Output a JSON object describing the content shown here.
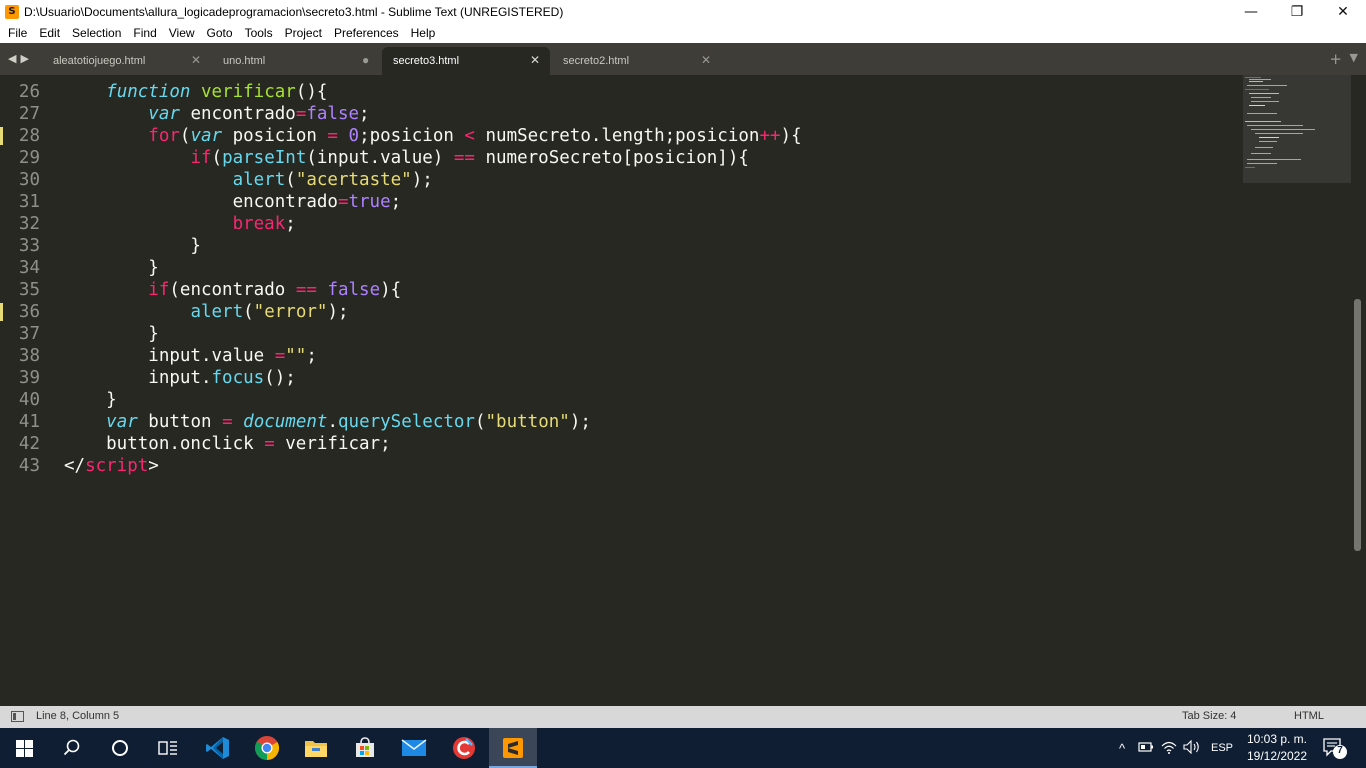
{
  "window": {
    "title": "D:\\Usuario\\Documents\\allura_logicadeprogramacion\\secreto3.html - Sublime Text (UNREGISTERED)",
    "app_icon_letter": "S",
    "minimize": "—",
    "maximize": "❐",
    "close": "✕"
  },
  "menu": [
    "File",
    "Edit",
    "Selection",
    "Find",
    "View",
    "Goto",
    "Tools",
    "Project",
    "Preferences",
    "Help"
  ],
  "tabs": [
    {
      "label": "aleatotiojuego.html",
      "state": "close"
    },
    {
      "label": "uno.html",
      "state": "modified"
    },
    {
      "label": "secreto3.html",
      "state": "active"
    },
    {
      "label": "secreto2.html",
      "state": "close"
    }
  ],
  "tab_controls": {
    "prev": "◀",
    "next": "▶",
    "new": "+",
    "more": "▼"
  },
  "code_lines": [
    {
      "n": "26",
      "mark": false
    },
    {
      "n": "27",
      "mark": false
    },
    {
      "n": "28",
      "mark": true
    },
    {
      "n": "29",
      "mark": false
    },
    {
      "n": "30",
      "mark": false
    },
    {
      "n": "31",
      "mark": false
    },
    {
      "n": "32",
      "mark": false
    },
    {
      "n": "33",
      "mark": false
    },
    {
      "n": "34",
      "mark": false
    },
    {
      "n": "35",
      "mark": false
    },
    {
      "n": "36",
      "mark": true
    },
    {
      "n": "37",
      "mark": false
    },
    {
      "n": "38",
      "mark": false
    },
    {
      "n": "39",
      "mark": false
    },
    {
      "n": "40",
      "mark": false
    },
    {
      "n": "41",
      "mark": false
    },
    {
      "n": "42",
      "mark": false
    },
    {
      "n": "43",
      "mark": false
    }
  ],
  "code": [
    [
      [
        "    ",
        "pl"
      ],
      [
        "function",
        "sk"
      ],
      [
        " ",
        "pl"
      ],
      [
        "verificar",
        "fn"
      ],
      [
        "(){",
        "pl"
      ]
    ],
    [
      [
        "        ",
        "pl"
      ],
      [
        "var",
        "sk"
      ],
      [
        " encontrado",
        "pl"
      ],
      [
        "=",
        "op"
      ],
      [
        "false",
        "cn"
      ],
      [
        ";",
        "pl"
      ]
    ],
    [
      [
        "        ",
        "pl"
      ],
      [
        "for",
        "kw"
      ],
      [
        "(",
        "pl"
      ],
      [
        "var",
        "sk"
      ],
      [
        " posicion ",
        "pl"
      ],
      [
        "=",
        "op"
      ],
      [
        " ",
        "pl"
      ],
      [
        "0",
        "cn"
      ],
      [
        ";posicion ",
        "pl"
      ],
      [
        "<",
        "op"
      ],
      [
        " numSecreto.length;posicion",
        "pl"
      ],
      [
        "++",
        "op"
      ],
      [
        "){",
        "pl"
      ]
    ],
    [
      [
        "            ",
        "pl"
      ],
      [
        "if",
        "kw"
      ],
      [
        "(",
        "pl"
      ],
      [
        "parseInt",
        "bi"
      ],
      [
        "(input.value) ",
        "pl"
      ],
      [
        "==",
        "op"
      ],
      [
        " numeroSecreto[posicion]){",
        "pl"
      ]
    ],
    [
      [
        "                ",
        "pl"
      ],
      [
        "alert",
        "bi"
      ],
      [
        "(",
        "pl"
      ],
      [
        "\"acertaste\"",
        "str"
      ],
      [
        ");",
        "pl"
      ]
    ],
    [
      [
        "                encontrado",
        "pl"
      ],
      [
        "=",
        "op"
      ],
      [
        "true",
        "cn"
      ],
      [
        ";",
        "pl"
      ]
    ],
    [
      [
        "                ",
        "pl"
      ],
      [
        "break",
        "kw"
      ],
      [
        ";",
        "pl"
      ]
    ],
    [
      [
        "            }",
        "pl"
      ]
    ],
    [
      [
        "        }",
        "pl"
      ]
    ],
    [
      [
        "        ",
        "pl"
      ],
      [
        "if",
        "kw"
      ],
      [
        "(encontrado ",
        "pl"
      ],
      [
        "==",
        "op"
      ],
      [
        " ",
        "pl"
      ],
      [
        "false",
        "cn"
      ],
      [
        "){",
        "pl"
      ]
    ],
    [
      [
        "            ",
        "pl"
      ],
      [
        "alert",
        "bi"
      ],
      [
        "(",
        "pl"
      ],
      [
        "\"error\"",
        "str"
      ],
      [
        ");",
        "pl"
      ]
    ],
    [
      [
        "        }",
        "pl"
      ]
    ],
    [
      [
        "        input.value ",
        "pl"
      ],
      [
        "=",
        "op"
      ],
      [
        "\"\"",
        "str"
      ],
      [
        ";",
        "pl"
      ]
    ],
    [
      [
        "        input.",
        "pl"
      ],
      [
        "focus",
        "bi"
      ],
      [
        "();",
        "pl"
      ]
    ],
    [
      [
        "    }",
        "pl"
      ]
    ],
    [
      [
        "    ",
        "pl"
      ],
      [
        "var",
        "sk"
      ],
      [
        " button ",
        "pl"
      ],
      [
        "=",
        "op"
      ],
      [
        " ",
        "pl"
      ],
      [
        "document",
        "sk"
      ],
      [
        ".",
        "pl"
      ],
      [
        "querySelector",
        "bi"
      ],
      [
        "(",
        "pl"
      ],
      [
        "\"button\"",
        "str"
      ],
      [
        ");",
        "pl"
      ]
    ],
    [
      [
        "    button.onclick ",
        "pl"
      ],
      [
        "=",
        "op"
      ],
      [
        " verificar;",
        "pl"
      ]
    ],
    [
      [
        "</",
        "pl"
      ],
      [
        "script",
        "kw"
      ],
      [
        ">",
        "pl"
      ]
    ]
  ],
  "status": {
    "position": "Line 8, Column 5",
    "tab_size": "Tab Size: 4",
    "syntax": "HTML"
  },
  "taskbar": {
    "apps": [
      "start-icon",
      "search-icon",
      "cortana-icon",
      "task-view-icon",
      "vscode-icon",
      "chrome-icon",
      "file-explorer-icon",
      "store-icon",
      "mail-icon",
      "ccleaner-icon",
      "sublime-text-icon"
    ],
    "language": "ESP",
    "time": "10:03 p. m.",
    "date": "19/12/2022",
    "notifications": "7"
  }
}
